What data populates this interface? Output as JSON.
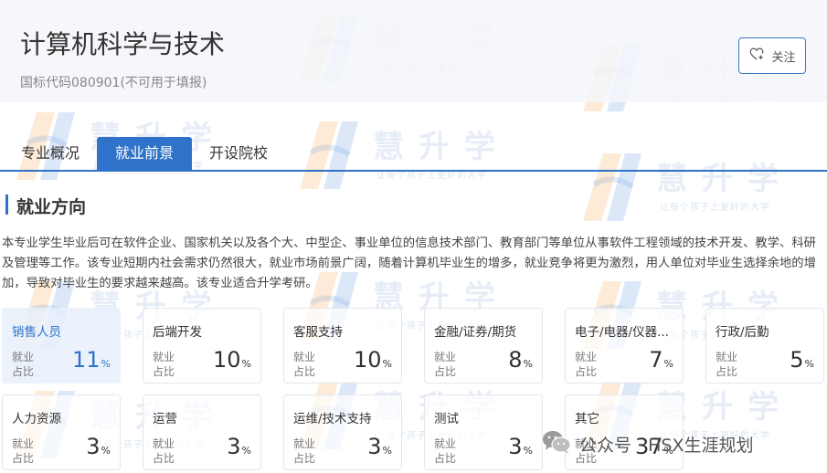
{
  "header": {
    "title": "计算机科学与技术",
    "code": "国标代码080901(不可用于填报)",
    "follow_label": "关注"
  },
  "tabs": [
    {
      "label": "专业概况",
      "active": false
    },
    {
      "label": "就业前景",
      "active": true
    },
    {
      "label": "开设院校",
      "active": false
    }
  ],
  "section": {
    "title": "就业方向",
    "description": "本专业学生毕业后可在软件企业、国家机关以及各个大、中型企、事业单位的信息技术部门、教育部门等单位从事软件工程领域的技术开发、教学、科研及管理等工作。该专业短期内社会需求仍然很大，就业市场前景广阔，随着计算机毕业生的增多，就业竞争将更为激烈，用人单位对毕业生选择余地的增加，导致对毕业生的要求越来越高。该专业适合升学考研。"
  },
  "stat_label": "就业占比",
  "stat_label_l1": "就业",
  "stat_label_l2": "占比",
  "unit": "%",
  "jobs": [
    {
      "name": "销售人员",
      "value": "11"
    },
    {
      "name": "后端开发",
      "value": "10"
    },
    {
      "name": "客服支持",
      "value": "10"
    },
    {
      "name": "金融/证券/期货",
      "value": "8"
    },
    {
      "name": "电子/电器/仪器...",
      "value": "7"
    },
    {
      "name": "行政/后勤",
      "value": "5"
    },
    {
      "name": "人力资源",
      "value": "3"
    },
    {
      "name": "运营",
      "value": "3"
    },
    {
      "name": "运维/技术支持",
      "value": "3"
    },
    {
      "name": "测试",
      "value": "3"
    },
    {
      "name": "其它",
      "value": "37"
    }
  ],
  "watermark": {
    "brand": "慧升学",
    "slogan": "让每个孩子上更好的大学"
  },
  "wechat_label": "公众号 · HSX生涯规划",
  "colors": {
    "accent": "#2f72c9",
    "highlight_bg": "#e8f0fb",
    "watermark_orange": "#f5a14b",
    "watermark_blue": "#3d7fd6"
  }
}
